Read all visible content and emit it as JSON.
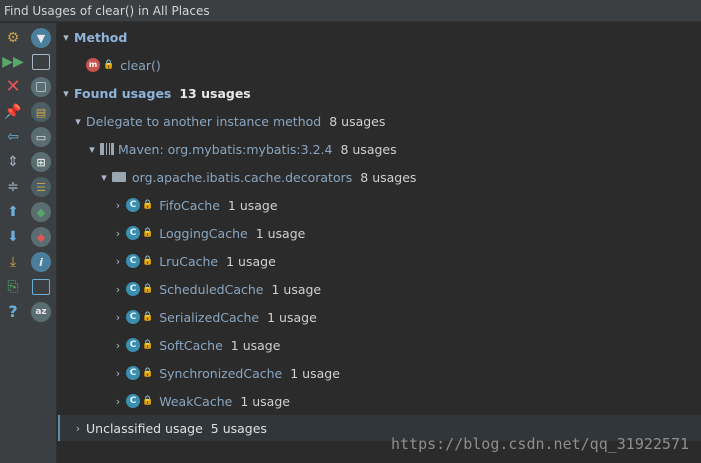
{
  "window": {
    "title": "Find Usages of clear() in All Places"
  },
  "toolbar": {
    "col1": [
      "rerun-settings-icon",
      "rerun-icon",
      "close-icon",
      "pin-icon",
      "previous-icon",
      "expand-all-icon",
      "collapse-all-icon",
      "up-arrow-icon",
      "down-arrow-icon",
      "export-icon",
      "open-in-new-icon",
      "help-icon"
    ],
    "col2": [
      "filter-icon",
      "group-by-module-icon",
      "group-by-usage-type-icon",
      "group-by-package-icon",
      "group-by-file-icon",
      "merge-duplicates-icon",
      "preview-icon",
      "navigate-next-icon",
      "navigate-previous-icon",
      "info-icon",
      "show-read-access-icon",
      "sort-az-icon"
    ]
  },
  "tree": {
    "method_header": "Method",
    "method_name": "clear()",
    "found_label": "Found usages",
    "found_count": "13 usages",
    "delegate_label": "Delegate to another instance method",
    "delegate_count": "8 usages",
    "maven_label": "Maven: org.mybatis:mybatis:3.2.4",
    "maven_count": "8 usages",
    "package_label": "org.apache.ibatis.cache.decorators",
    "package_count": "8 usages",
    "classes": [
      {
        "name": "FifoCache",
        "count": "1 usage"
      },
      {
        "name": "LoggingCache",
        "count": "1 usage"
      },
      {
        "name": "LruCache",
        "count": "1 usage"
      },
      {
        "name": "ScheduledCache",
        "count": "1 usage"
      },
      {
        "name": "SerializedCache",
        "count": "1 usage"
      },
      {
        "name": "SoftCache",
        "count": "1 usage"
      },
      {
        "name": "SynchronizedCache",
        "count": "1 usage"
      },
      {
        "name": "WeakCache",
        "count": "1 usage"
      }
    ],
    "unclassified_label": "Unclassified usage",
    "unclassified_count": "5 usages"
  },
  "watermark": "https://blog.csdn.net/qq_31922571",
  "colors": {
    "background": "#2b2b2b",
    "toolbar": "#3c3f41",
    "header_text": "#8fb4dc",
    "class_icon": "#3b8fb0",
    "method_icon": "#c75450"
  }
}
